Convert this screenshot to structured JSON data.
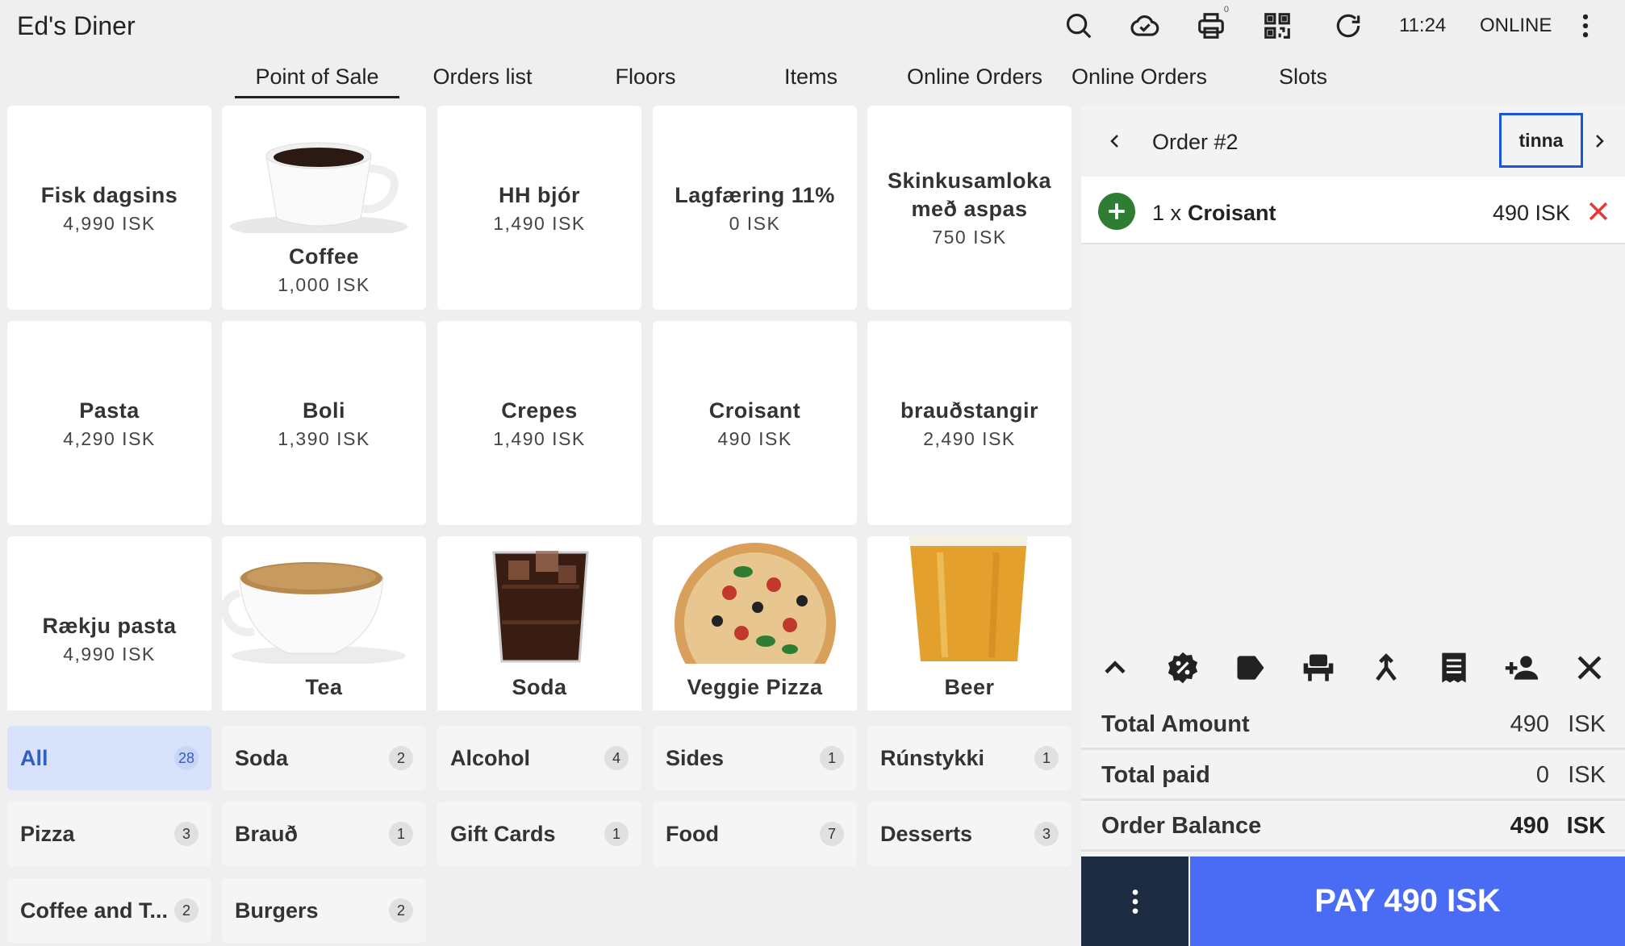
{
  "app": {
    "title": "Ed's Diner",
    "clock": "11:24",
    "status": "ONLINE",
    "printer_count": "0"
  },
  "tabs": [
    {
      "label": "Point of Sale",
      "active": true
    },
    {
      "label": "Orders list"
    },
    {
      "label": "Floors"
    },
    {
      "label": "Items"
    },
    {
      "label": "Online Orders"
    },
    {
      "label": "Online Orders"
    },
    {
      "label": "Slots"
    }
  ],
  "items": [
    {
      "name": "Fisk dagsins",
      "price": "4,990 ISK"
    },
    {
      "name": "Coffee",
      "price": "1,000 ISK",
      "image": "coffee-cup"
    },
    {
      "name": "HH bjór",
      "price": "1,490 ISK"
    },
    {
      "name": "Lagfæring 11%",
      "price": "0 ISK"
    },
    {
      "name": "Skinkusamloka með aspas",
      "price": "750 ISK"
    },
    {
      "name": "Pasta",
      "price": "4,290 ISK"
    },
    {
      "name": "Boli",
      "price": "1,390 ISK"
    },
    {
      "name": "Crepes",
      "price": "1,490 ISK"
    },
    {
      "name": "Croisant",
      "price": "490 ISK"
    },
    {
      "name": "brauðstangir",
      "price": "2,490 ISK"
    },
    {
      "name": "Rækju pasta",
      "price": "4,990 ISK"
    },
    {
      "name": "Tea",
      "image": "tea-cup"
    },
    {
      "name": "Soda",
      "image": "soda-glass"
    },
    {
      "name": "Veggie Pizza",
      "image": "pizza"
    },
    {
      "name": "Beer",
      "image": "beer-glass"
    }
  ],
  "categories": [
    {
      "name": "All",
      "count": "28",
      "active": true
    },
    {
      "name": "Soda",
      "count": "2"
    },
    {
      "name": "Alcohol",
      "count": "4"
    },
    {
      "name": "Sides",
      "count": "1"
    },
    {
      "name": "Rúnstykki",
      "count": "1"
    },
    {
      "name": "Pizza",
      "count": "3"
    },
    {
      "name": "Brauð",
      "count": "1"
    },
    {
      "name": "Gift Cards",
      "count": "1"
    },
    {
      "name": "Food",
      "count": "7"
    },
    {
      "name": "Desserts",
      "count": "3"
    },
    {
      "name": "Coffee and T...",
      "count": "2"
    },
    {
      "name": "Burgers",
      "count": "2"
    }
  ],
  "order": {
    "title": "Order #2",
    "user": "tinna",
    "lines": [
      {
        "qty": "1 x",
        "name": "Croisant",
        "price": "490 ISK"
      }
    ],
    "totals": [
      {
        "label": "Total Amount",
        "value": "490",
        "currency": "ISK"
      },
      {
        "label": "Total paid",
        "value": "0",
        "currency": "ISK"
      },
      {
        "label": "Order Balance",
        "value": "490",
        "currency": "ISK"
      }
    ],
    "pay_label": "PAY 490 ISK"
  },
  "colors": {
    "accent": "#4a6cf5",
    "dark": "#1d2c41",
    "add": "#2e7d32",
    "remove": "#e53935",
    "category_active": "#d9e2fb"
  }
}
